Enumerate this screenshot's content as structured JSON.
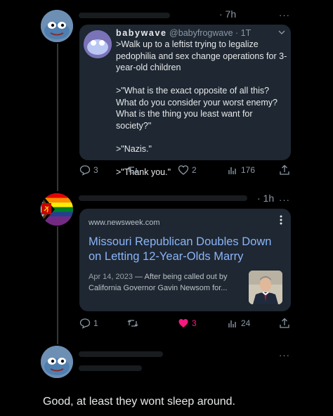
{
  "posts": [
    {
      "time": "· 7h",
      "more": "···",
      "quote": {
        "display_name": "babywave",
        "handle": "@babyfrogwave · 1T",
        "paragraphs": [
          ">Walk up to a leftist trying to legalize pedophilia and sex change operations for 3-year-old children",
          ">\"What is the exact opposite of all this? What do you consider your worst enemy? What is the thing you least want for society?\"",
          ">\"Nazis.\"",
          ">\"Thank you.\""
        ]
      },
      "actions": {
        "replies": "3",
        "retweets": "",
        "likes": "2",
        "views": "176"
      }
    },
    {
      "time": "· 1h",
      "more": "···",
      "link_card": {
        "domain": "www.newsweek.com",
        "title": "Missouri Republican Doubles Down on Letting 12-Year-Olds Marry",
        "date": "Apr 14, 2023",
        "snippet": " — After being called out by California Governor Gavin Newsom for..."
      },
      "actions": {
        "replies": "1",
        "retweets": "",
        "likes": "3",
        "views": "24"
      }
    },
    {
      "more": "···",
      "text": "Good, at least they wont sleep around."
    }
  ],
  "colors": {
    "like_active": "#f91880",
    "link": "#8ab4f8",
    "muted": "#8b98a5"
  }
}
